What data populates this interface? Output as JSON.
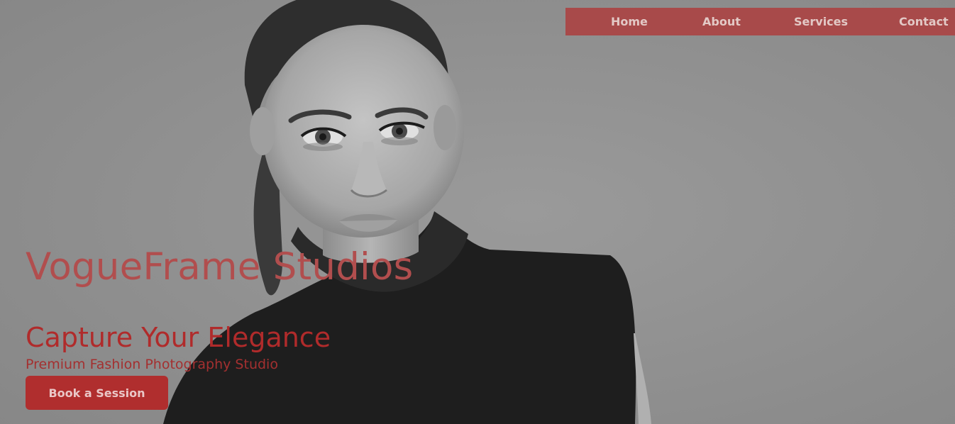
{
  "nav": {
    "items": [
      {
        "label": "Home"
      },
      {
        "label": "About"
      },
      {
        "label": "Services"
      },
      {
        "label": "Contact"
      }
    ]
  },
  "hero": {
    "brand": "VogueFrame Studios",
    "tagline": "Capture Your Elegance",
    "subtitle": "Premium Fashion Photography Studio",
    "cta_label": "Book a Session"
  },
  "colors": {
    "accent": "#b02e2e",
    "nav_background": "#a84a4a",
    "nav_text": "#e3c9c6",
    "background": "#8f8f8f"
  }
}
